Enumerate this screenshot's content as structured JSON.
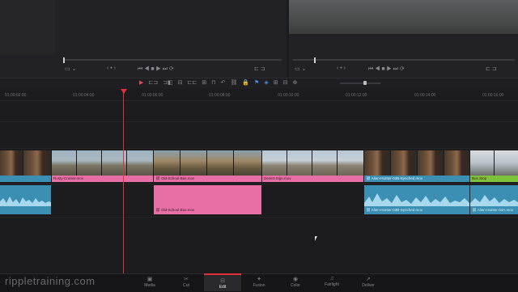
{
  "toolbar": {
    "tools": [
      "▶",
      "⊏⊐",
      "⊐◧",
      "⊟",
      "⊏⊏",
      "⊞",
      "⊓",
      "⊔",
      "⊡",
      "↶",
      "⛓",
      "🔒",
      "⚑",
      "◈",
      "⊞",
      "⊟",
      "⊕"
    ]
  },
  "ruler": {
    "timecodes": [
      "01:00:02:00",
      "01:00:04:00",
      "01:00:06:00",
      "01:00:08:00",
      "01:00:10:00",
      "01:00:12:00",
      "01:00:14:00",
      "01:00:16:00"
    ]
  },
  "clips": {
    "video": [
      {
        "label": ""
      },
      {
        "label": "Rusty-Cruiser.mov"
      },
      {
        "label": "Old-School-Bus.mov"
      },
      {
        "label": "Desert-Sign.mov"
      },
      {
        "label": "Alien-Hunter-03B-Synched.mov"
      },
      {
        "label": "Bus Stop"
      }
    ],
    "audio": [
      {
        "label": ""
      },
      {
        "label": "Old-School-Bus.mov"
      },
      {
        "label": "Alien-Hunter-03B-Synched.mov"
      },
      {
        "label": "Alien-Hunter-04A.mov"
      }
    ]
  },
  "pages": [
    {
      "label": "Media",
      "icon": "▣"
    },
    {
      "label": "Cut",
      "icon": "✂"
    },
    {
      "label": "Edit",
      "icon": "⊟"
    },
    {
      "label": "Fusion",
      "icon": "✦"
    },
    {
      "label": "Color",
      "icon": "◉"
    },
    {
      "label": "Fairlight",
      "icon": "♫"
    },
    {
      "label": "Deliver",
      "icon": "➚"
    }
  ],
  "watermark": "rippletraining.com",
  "colors": {
    "accent": "#e0303c",
    "video_clip": "#e86fa6",
    "synched_clip": "#3b8fb2",
    "bus_stop_clip": "#7dc23a"
  }
}
